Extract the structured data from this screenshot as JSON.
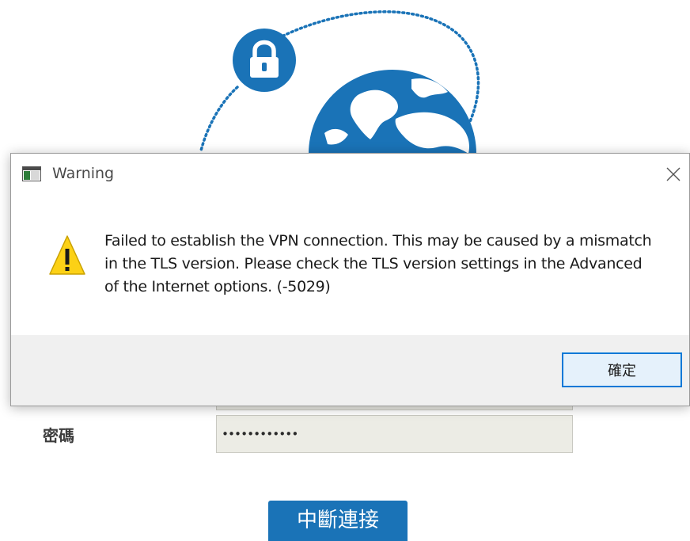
{
  "background": {
    "password_label": "密碼",
    "password_value": "••••••••••••",
    "disconnect_button_label": "中斷連接",
    "accent_color": "#1a73b7"
  },
  "dialog": {
    "title": "Warning",
    "message": "Failed to establish the VPN connection. This may be caused by a mismatch in the TLS version. Please check the TLS version settings in the Advanced of the Internet options. (-5029)",
    "ok_button_label": "確定",
    "icons": {
      "app": "window-app-icon",
      "close": "close-icon",
      "warning": "warning-icon"
    }
  }
}
